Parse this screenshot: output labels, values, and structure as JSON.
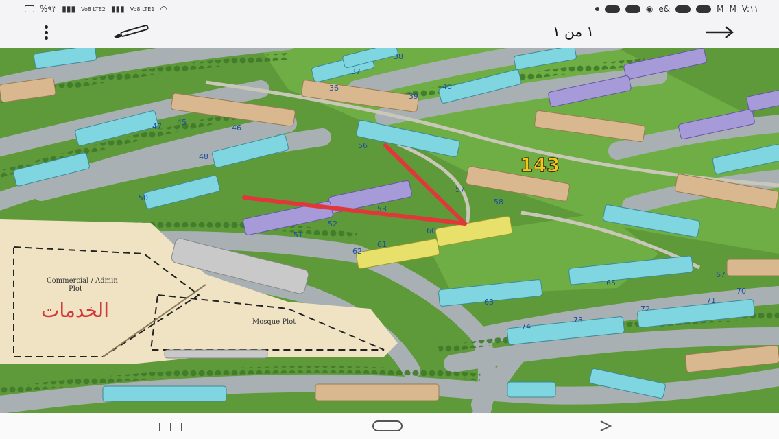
{
  "status": {
    "left": {
      "percent": "%٩٣",
      "lte1": "Vo8 LTE2",
      "lte2": "Vo8 LTE1"
    },
    "time": "V:١١"
  },
  "toolbar": {
    "page_indicator": "١ من ١"
  },
  "map": {
    "area_number": "143",
    "commercial_label": "Commercial / Admin Plot",
    "commercial_label_line1": "Commercial / Admin",
    "commercial_label_line2": "Plot",
    "mosque_label": "Mosque Plot",
    "services_label": "الخدمات",
    "colors": {
      "grass": "#5f9a3a",
      "road": "#a9b0b4",
      "plot": "#efe3c4",
      "cyan": "#7fd6e0",
      "purple": "#a79ad8",
      "tan": "#d9b890",
      "yellow": "#e7e06a",
      "marker": "#e0373b",
      "label_gold": "#f2c81e"
    },
    "unit_numbers": {
      "n36": "36",
      "n37": "37",
      "n38": "38",
      "n39": "39",
      "n40": "40",
      "n45": "45",
      "n46": "46",
      "n47": "47",
      "n48": "48",
      "n50": "50",
      "n51": "51",
      "n52": "52",
      "n53": "53",
      "n56": "56",
      "n57": "57",
      "n58": "58",
      "n60": "60",
      "n61": "61",
      "n62": "62",
      "n63": "63",
      "n65": "65",
      "n67": "67",
      "n70": "70",
      "n71": "71",
      "n72": "72",
      "n73": "73",
      "n74": "74"
    }
  }
}
